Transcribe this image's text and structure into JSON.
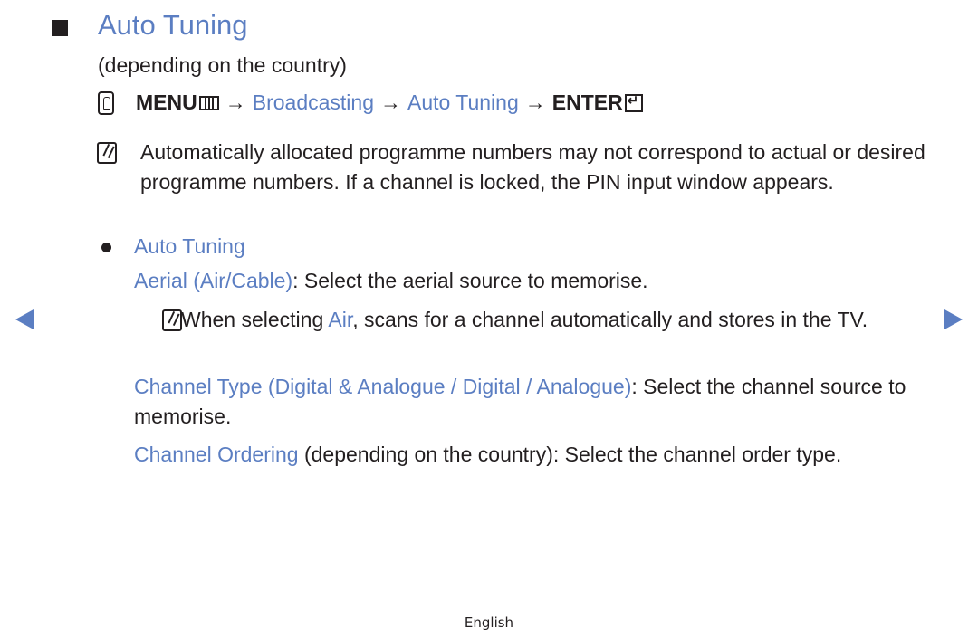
{
  "heading": {
    "title": "Auto Tuning",
    "subtitle": "(depending on the country)"
  },
  "menu_path": {
    "menu_label": "MENU",
    "arrow": "→",
    "step1": "Broadcasting",
    "step2": "Auto Tuning",
    "enter_label": "ENTER"
  },
  "note1": {
    "text": "Automatically allocated programme numbers may not correspond to actual or desired programme numbers. If a channel is locked, the PIN input window appears."
  },
  "section": {
    "bullet_title": "Auto Tuning",
    "aerial_label": "Aerial (Air/Cable)",
    "aerial_text": ": Select the aerial source to memorise.",
    "note2_before": "When selecting ",
    "note2_highlight": "Air",
    "note2_after": ", scans for a channel automatically and stores in the TV.",
    "channel_type_label": "Channel Type (Digital & Analogue / Digital / Analogue)",
    "channel_type_text": ": Select the channel source to memorise.",
    "channel_ordering_label": "Channel Ordering",
    "channel_ordering_text": " (depending on the country): Select the channel order type."
  },
  "navigation": {
    "prev_icon": "left-triangle",
    "next_icon": "right-triangle"
  },
  "footer": {
    "language": "English"
  },
  "colors": {
    "accent": "#5b7ec2",
    "text": "#231f20"
  }
}
